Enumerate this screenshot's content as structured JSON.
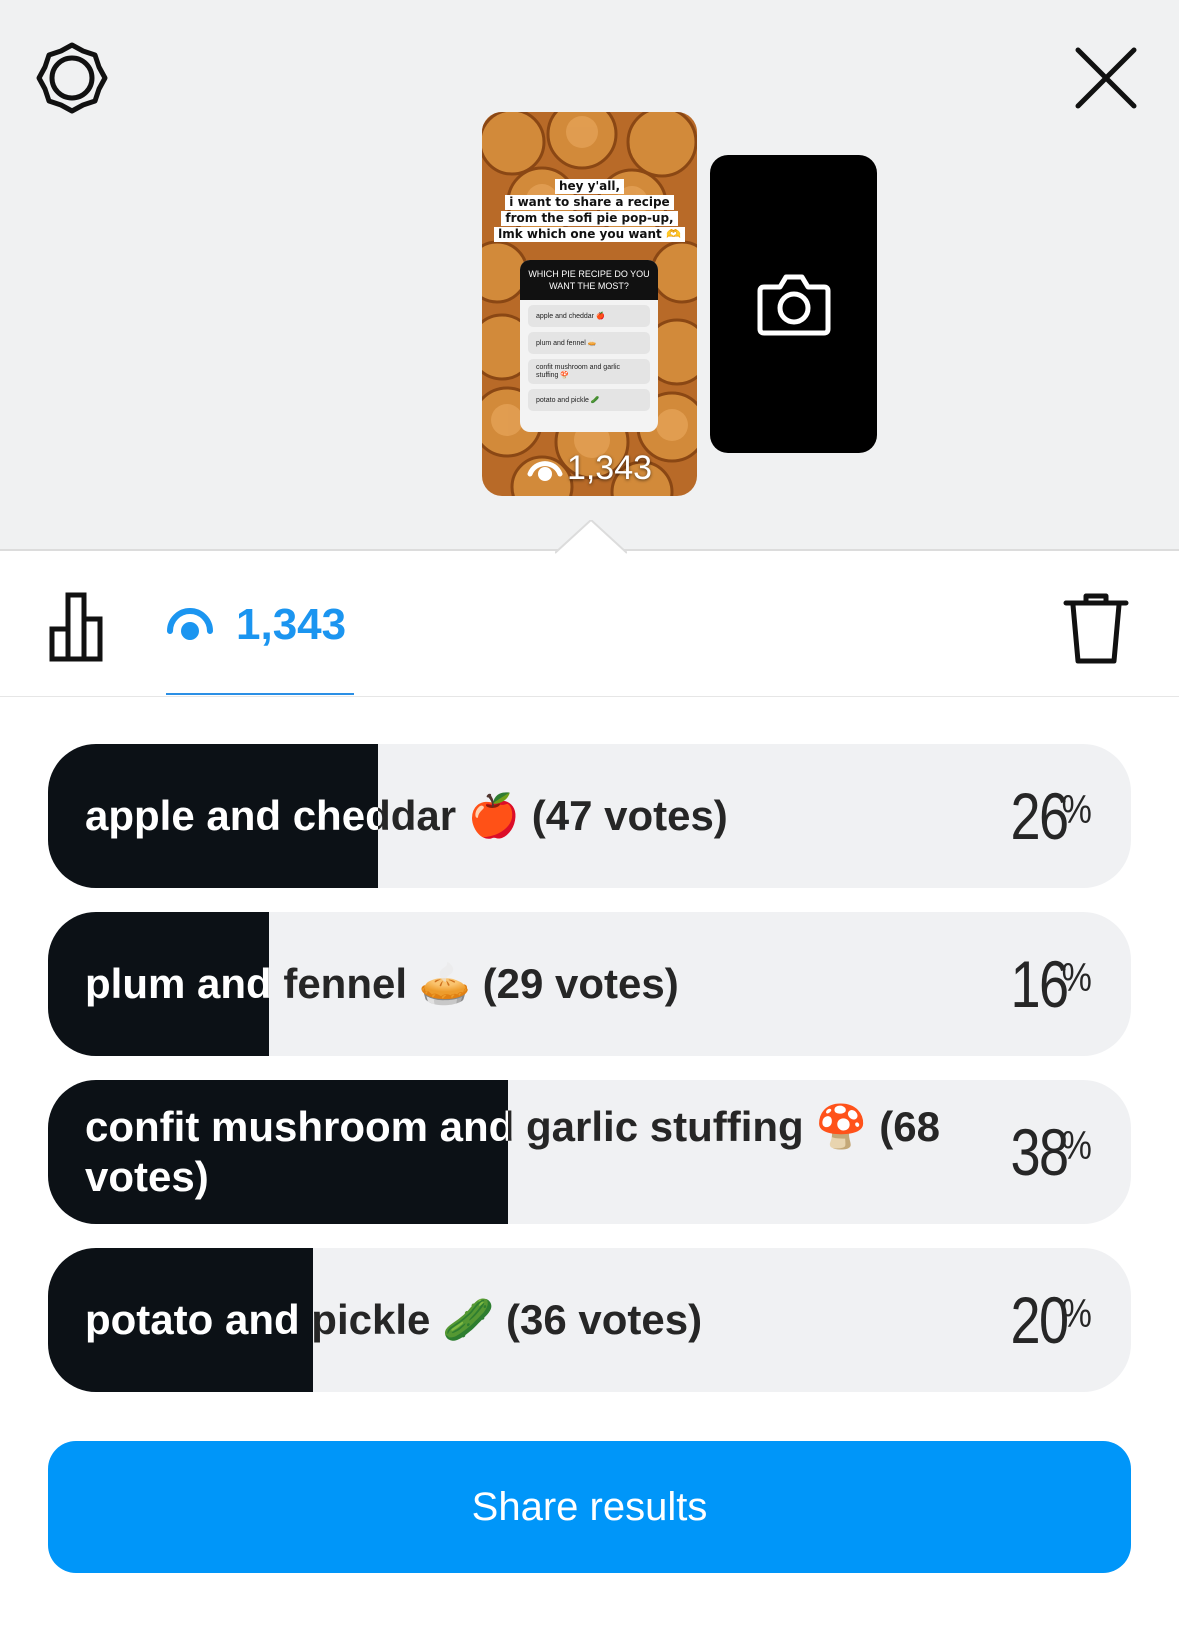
{
  "story": {
    "caption_lines": [
      "hey y'all,",
      "i want to share a recipe",
      "from the sofi pie pop-up,",
      "lmk which one you want 🫶"
    ],
    "poll_question": "WHICH PIE RECIPE DO YOU WANT THE MOST?",
    "poll_options": [
      "apple and cheddar 🍎",
      "plum and fennel 🥧",
      "confit mushroom and garlic stuffing 🍄",
      "potato and pickle 🥒"
    ],
    "views": "1,343"
  },
  "icons": {
    "settings": "gear-icon",
    "close": "close-icon",
    "camera": "camera-icon",
    "results_tab": "bar-chart-icon",
    "viewers_tab": "eye-icon",
    "delete": "trash-icon"
  },
  "tabs": {
    "views_count": "1,343"
  },
  "colors": {
    "accent": "#0096f9",
    "views_blue": "#1b95f0",
    "bar_fill": "#0c1116",
    "bar_track": "#f0f1f3"
  },
  "poll_results": [
    {
      "label": "apple and cheddar 🍎 (47 votes)",
      "votes": 47,
      "percent": 26,
      "percent_text": "26"
    },
    {
      "label": "plum and fennel 🥧 (29 votes)",
      "votes": 29,
      "percent": 16,
      "percent_text": "16"
    },
    {
      "label": "confit mushroom and garlic stuffing 🍄 (68 votes)",
      "votes": 68,
      "percent": 38,
      "percent_text": "38"
    },
    {
      "label": "potato and pickle 🥒 (36 votes)",
      "votes": 36,
      "percent": 20,
      "percent_text": "20"
    }
  ],
  "percent_sign": "%",
  "share_button": "Share results"
}
